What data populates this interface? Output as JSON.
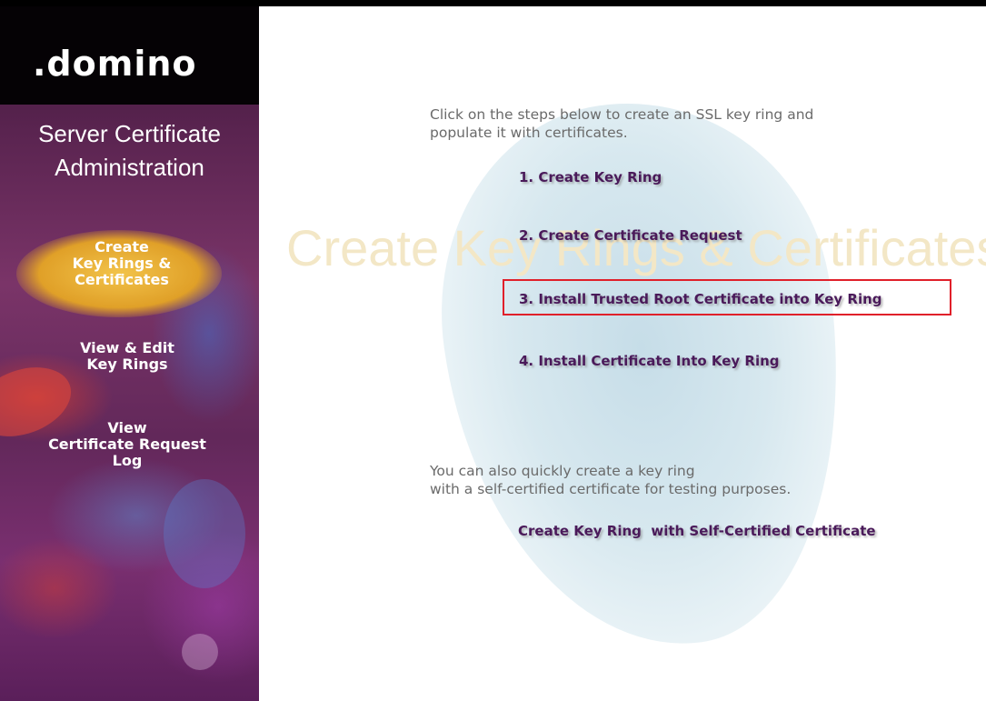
{
  "sidebar": {
    "logo": ".domino",
    "title": "Server Certificate\nAdministration",
    "items": [
      {
        "label": "Create\nKey Rings &\nCertificates",
        "active": true
      },
      {
        "label": "View & Edit\nKey Rings",
        "active": false
      },
      {
        "label": "View\nCertificate Request\nLog",
        "active": false
      }
    ]
  },
  "main": {
    "watermark": "Create Key Rings & Certificates",
    "intro": "Click on the steps below to create an SSL key ring and\npopulate it with certificates.",
    "steps": [
      {
        "label": "1. Create Key Ring"
      },
      {
        "label": "2. Create Certificate Request"
      },
      {
        "label": "3. Install Trusted Root Certificate into Key Ring",
        "highlighted": true
      },
      {
        "label": "4. Install Certificate Into Key Ring"
      }
    ],
    "self_cert_text": "You can also quickly create a key ring\nwith a self-certified certificate for testing purposes.",
    "self_cert_link": "Create Key Ring  with Self-Certified Certificate"
  },
  "colors": {
    "sidebar_bg": "#5a2450",
    "active_glow": "#f2c34a",
    "link": "#4a1a5a",
    "highlight_border": "#e0202a",
    "watermark": "#f3e7c6"
  }
}
